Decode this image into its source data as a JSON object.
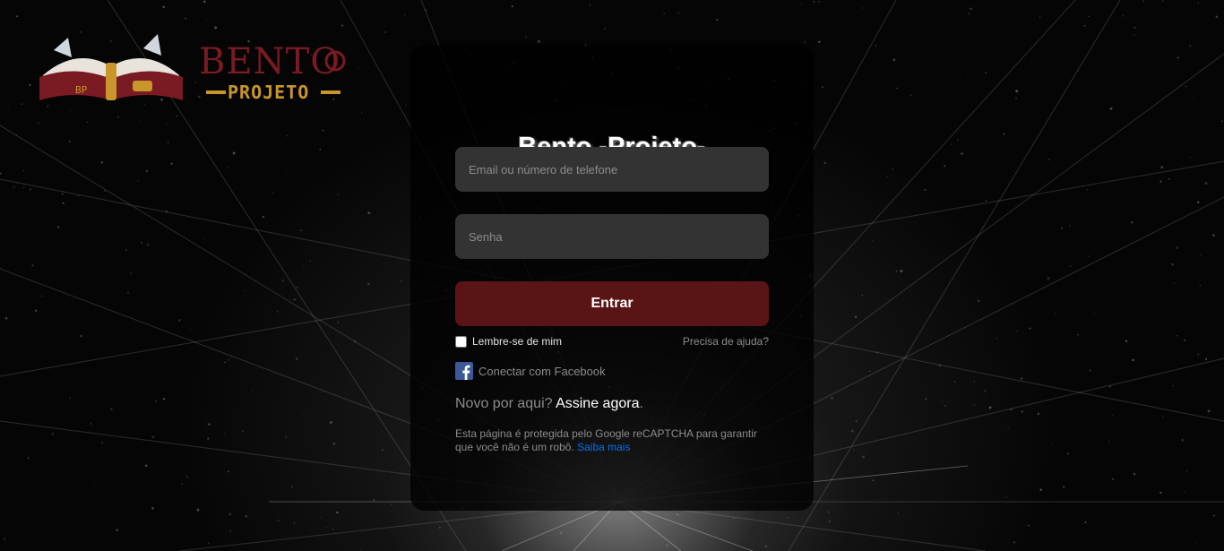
{
  "brand": {
    "logo_word": "BENTO",
    "logo_sub": "PROJETO",
    "book_badge": "BP"
  },
  "login": {
    "title": "Bento -Projeto-",
    "email_placeholder": "Email ou número de telefone",
    "password_placeholder": "Senha",
    "submit_label": "Entrar",
    "remember_label": "Lembre-se de mim",
    "help_link": "Precisa de ajuda?",
    "facebook_label": "Conectar com Facebook",
    "signup_prompt": "Novo por aqui?",
    "signup_link": "Assine agora",
    "signup_end": ".",
    "captcha_text": "Esta página é protegida pelo Google reCAPTCHA para garantir que você não é um robô.",
    "captcha_link": "Saiba mais"
  },
  "colors": {
    "submit_bg": "#5b1416",
    "facebook": "#3b5998",
    "link_blue": "#0071eb",
    "logo_red": "#7a1a22",
    "logo_gold": "#c8962a"
  }
}
